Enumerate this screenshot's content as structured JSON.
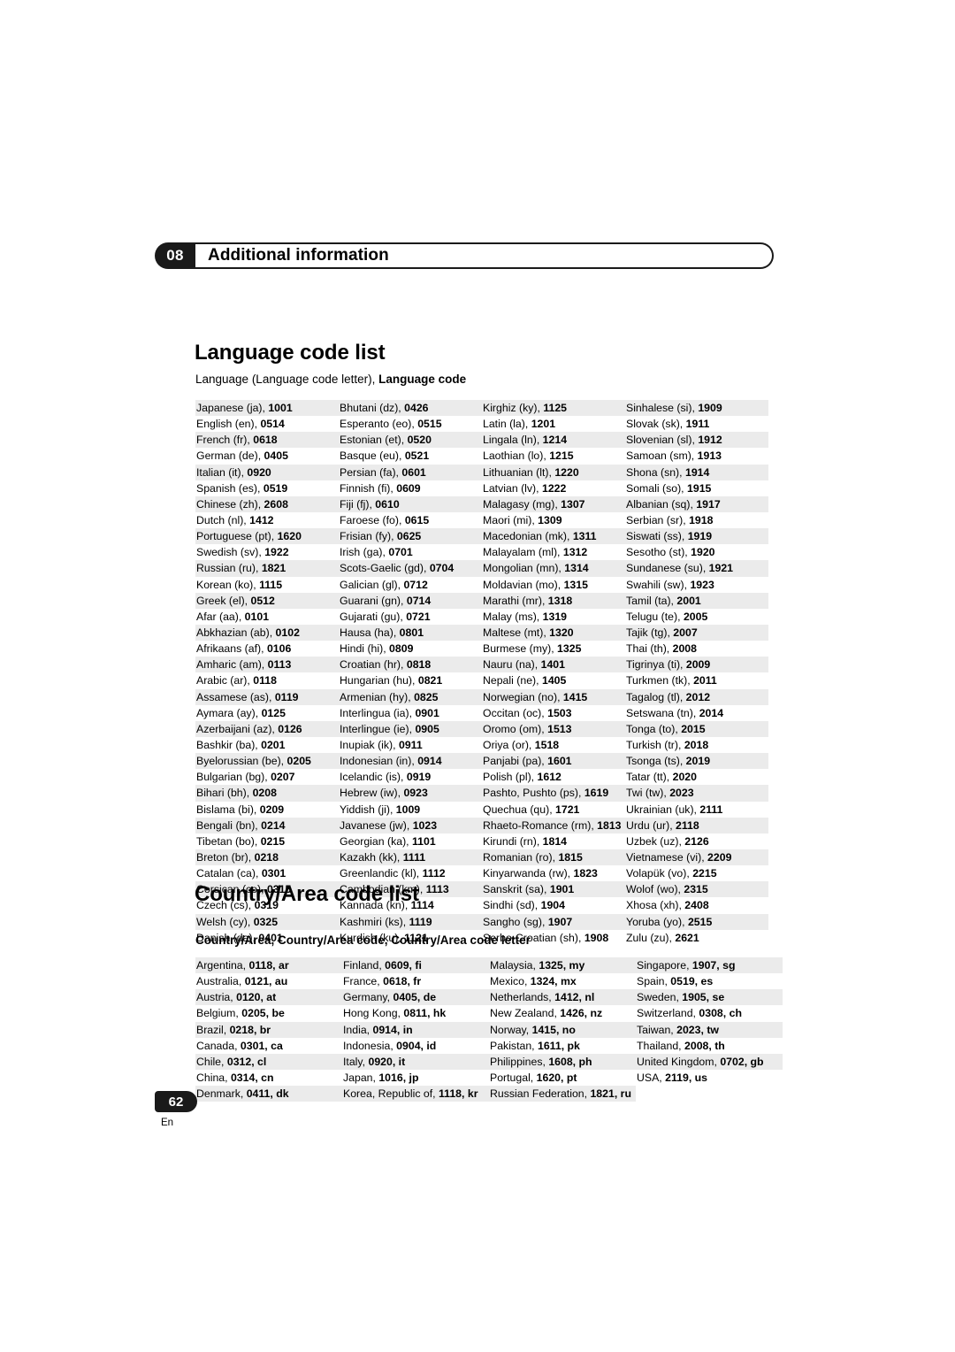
{
  "chapter": {
    "number": "08",
    "title": "Additional information"
  },
  "language_section": {
    "title": "Language code list",
    "subtitle_plain": "Language (Language code letter), ",
    "subtitle_bold": "Language code",
    "columns": [
      [
        {
          "name": "Japanese (ja)",
          "code": "1001"
        },
        {
          "name": "English (en)",
          "code": "0514"
        },
        {
          "name": "French (fr)",
          "code": "0618"
        },
        {
          "name": "German (de)",
          "code": "0405"
        },
        {
          "name": "Italian (it)",
          "code": "0920"
        },
        {
          "name": "Spanish (es)",
          "code": "0519"
        },
        {
          "name": "Chinese (zh)",
          "code": "2608"
        },
        {
          "name": "Dutch (nl)",
          "code": "1412"
        },
        {
          "name": "Portuguese (pt)",
          "code": "1620"
        },
        {
          "name": "Swedish (sv)",
          "code": "1922"
        },
        {
          "name": "Russian (ru)",
          "code": "1821"
        },
        {
          "name": "Korean (ko)",
          "code": "1115"
        },
        {
          "name": "Greek (el)",
          "code": "0512"
        },
        {
          "name": "Afar (aa)",
          "code": "0101"
        },
        {
          "name": "Abkhazian (ab)",
          "code": "0102"
        },
        {
          "name": "Afrikaans (af)",
          "code": "0106"
        },
        {
          "name": "Amharic (am)",
          "code": "0113"
        },
        {
          "name": "Arabic (ar)",
          "code": "0118"
        },
        {
          "name": "Assamese (as)",
          "code": "0119"
        },
        {
          "name": "Aymara (ay)",
          "code": "0125"
        },
        {
          "name": "Azerbaijani (az)",
          "code": "0126"
        },
        {
          "name": "Bashkir (ba)",
          "code": "0201"
        },
        {
          "name": "Byelorussian (be)",
          "code": "0205"
        },
        {
          "name": "Bulgarian (bg)",
          "code": "0207"
        },
        {
          "name": "Bihari (bh)",
          "code": "0208"
        },
        {
          "name": "Bislama (bi)",
          "code": "0209"
        },
        {
          "name": "Bengali (bn)",
          "code": "0214"
        },
        {
          "name": "Tibetan (bo)",
          "code": "0215"
        },
        {
          "name": "Breton (br)",
          "code": "0218"
        },
        {
          "name": "Catalan (ca)",
          "code": "0301"
        },
        {
          "name": "Corsican (co)",
          "code": "0315"
        },
        {
          "name": "Czech (cs)",
          "code": "0319"
        },
        {
          "name": "Welsh (cy)",
          "code": "0325"
        },
        {
          "name": "Danish (da)",
          "code": "0401"
        }
      ],
      [
        {
          "name": "Bhutani (dz)",
          "code": "0426"
        },
        {
          "name": "Esperanto (eo)",
          "code": "0515"
        },
        {
          "name": "Estonian (et)",
          "code": "0520"
        },
        {
          "name": "Basque (eu)",
          "code": "0521"
        },
        {
          "name": "Persian (fa)",
          "code": "0601"
        },
        {
          "name": "Finnish (fi)",
          "code": "0609"
        },
        {
          "name": "Fiji (fj)",
          "code": "0610"
        },
        {
          "name": "Faroese (fo)",
          "code": "0615"
        },
        {
          "name": "Frisian (fy)",
          "code": "0625"
        },
        {
          "name": "Irish (ga)",
          "code": "0701"
        },
        {
          "name": "Scots-Gaelic (gd)",
          "code": "0704"
        },
        {
          "name": "Galician (gl)",
          "code": "0712"
        },
        {
          "name": "Guarani (gn)",
          "code": "0714"
        },
        {
          "name": "Gujarati (gu)",
          "code": "0721"
        },
        {
          "name": "Hausa (ha)",
          "code": "0801"
        },
        {
          "name": "Hindi (hi)",
          "code": "0809"
        },
        {
          "name": "Croatian (hr)",
          "code": "0818"
        },
        {
          "name": "Hungarian (hu)",
          "code": "0821"
        },
        {
          "name": "Armenian (hy)",
          "code": "0825"
        },
        {
          "name": "Interlingua (ia)",
          "code": "0901"
        },
        {
          "name": "Interlingue (ie)",
          "code": "0905"
        },
        {
          "name": "Inupiak (ik)",
          "code": "0911"
        },
        {
          "name": "Indonesian (in)",
          "code": "0914"
        },
        {
          "name": "Icelandic (is)",
          "code": "0919"
        },
        {
          "name": "Hebrew (iw)",
          "code": "0923"
        },
        {
          "name": "Yiddish (ji)",
          "code": "1009"
        },
        {
          "name": "Javanese (jw)",
          "code": "1023"
        },
        {
          "name": "Georgian (ka)",
          "code": "1101"
        },
        {
          "name": "Kazakh (kk)",
          "code": "1111"
        },
        {
          "name": "Greenlandic (kl)",
          "code": "1112"
        },
        {
          "name": "Cambodian (km)",
          "code": "1113"
        },
        {
          "name": "Kannada (kn)",
          "code": "1114"
        },
        {
          "name": "Kashmiri (ks)",
          "code": "1119"
        },
        {
          "name": "Kurdish (ku)",
          "code": "1121"
        }
      ],
      [
        {
          "name": "Kirghiz (ky)",
          "code": "1125"
        },
        {
          "name": "Latin (la)",
          "code": "1201"
        },
        {
          "name": "Lingala (ln)",
          "code": "1214"
        },
        {
          "name": "Laothian (lo)",
          "code": "1215"
        },
        {
          "name": "Lithuanian (lt)",
          "code": "1220"
        },
        {
          "name": "Latvian (lv)",
          "code": "1222"
        },
        {
          "name": "Malagasy (mg)",
          "code": "1307"
        },
        {
          "name": "Maori (mi)",
          "code": "1309"
        },
        {
          "name": "Macedonian (mk)",
          "code": "1311"
        },
        {
          "name": "Malayalam (ml)",
          "code": "1312"
        },
        {
          "name": "Mongolian (mn)",
          "code": "1314"
        },
        {
          "name": "Moldavian (mo)",
          "code": "1315"
        },
        {
          "name": "Marathi (mr)",
          "code": "1318"
        },
        {
          "name": "Malay (ms)",
          "code": "1319"
        },
        {
          "name": "Maltese (mt)",
          "code": "1320"
        },
        {
          "name": "Burmese (my)",
          "code": "1325"
        },
        {
          "name": "Nauru (na)",
          "code": "1401"
        },
        {
          "name": "Nepali (ne)",
          "code": "1405"
        },
        {
          "name": "Norwegian (no)",
          "code": "1415"
        },
        {
          "name": "Occitan (oc)",
          "code": "1503"
        },
        {
          "name": "Oromo (om)",
          "code": "1513"
        },
        {
          "name": "Oriya (or)",
          "code": "1518"
        },
        {
          "name": "Panjabi (pa)",
          "code": "1601"
        },
        {
          "name": "Polish (pl)",
          "code": "1612"
        },
        {
          "name": "Pashto, Pushto (ps)",
          "code": "1619"
        },
        {
          "name": "Quechua (qu)",
          "code": "1721"
        },
        {
          "name": "Rhaeto-Romance (rm)",
          "code": "1813"
        },
        {
          "name": "Kirundi (rn)",
          "code": "1814"
        },
        {
          "name": "Romanian (ro)",
          "code": "1815"
        },
        {
          "name": "Kinyarwanda (rw)",
          "code": "1823"
        },
        {
          "name": "Sanskrit (sa)",
          "code": "1901"
        },
        {
          "name": "Sindhi (sd)",
          "code": "1904"
        },
        {
          "name": "Sangho (sg)",
          "code": "1907"
        },
        {
          "name": "Serbo-Croatian (sh)",
          "code": "1908"
        }
      ],
      [
        {
          "name": "Sinhalese (si)",
          "code": "1909"
        },
        {
          "name": "Slovak (sk)",
          "code": "1911"
        },
        {
          "name": "Slovenian (sl)",
          "code": "1912"
        },
        {
          "name": "Samoan (sm)",
          "code": "1913"
        },
        {
          "name": "Shona (sn)",
          "code": "1914"
        },
        {
          "name": "Somali (so)",
          "code": "1915"
        },
        {
          "name": "Albanian (sq)",
          "code": "1917"
        },
        {
          "name": "Serbian (sr)",
          "code": "1918"
        },
        {
          "name": "Siswati (ss)",
          "code": "1919"
        },
        {
          "name": "Sesotho (st)",
          "code": "1920"
        },
        {
          "name": "Sundanese (su)",
          "code": "1921"
        },
        {
          "name": "Swahili (sw)",
          "code": "1923"
        },
        {
          "name": "Tamil (ta)",
          "code": "2001"
        },
        {
          "name": "Telugu (te)",
          "code": "2005"
        },
        {
          "name": "Tajik (tg)",
          "code": "2007"
        },
        {
          "name": "Thai (th)",
          "code": "2008"
        },
        {
          "name": "Tigrinya (ti)",
          "code": "2009"
        },
        {
          "name": "Turkmen (tk)",
          "code": "2011"
        },
        {
          "name": "Tagalog (tl)",
          "code": "2012"
        },
        {
          "name": "Setswana (tn)",
          "code": "2014"
        },
        {
          "name": "Tonga (to)",
          "code": "2015"
        },
        {
          "name": "Turkish (tr)",
          "code": "2018"
        },
        {
          "name": "Tsonga (ts)",
          "code": "2019"
        },
        {
          "name": "Tatar (tt)",
          "code": "2020"
        },
        {
          "name": "Twi (tw)",
          "code": "2023"
        },
        {
          "name": "Ukrainian (uk)",
          "code": "2111"
        },
        {
          "name": "Urdu (ur)",
          "code": "2118"
        },
        {
          "name": "Uzbek (uz)",
          "code": "2126"
        },
        {
          "name": "Vietnamese (vi)",
          "code": "2209"
        },
        {
          "name": "Volapük (vo)",
          "code": "2215"
        },
        {
          "name": "Wolof (wo)",
          "code": "2315"
        },
        {
          "name": "Xhosa (xh)",
          "code": "2408"
        },
        {
          "name": "Yoruba (yo)",
          "code": "2515"
        },
        {
          "name": "Zulu (zu)",
          "code": "2621"
        }
      ]
    ]
  },
  "country_section": {
    "title": "Country/Area code list",
    "subtitle": "Country/Area, Country/Area code, Country/Area code letter",
    "columns": [
      [
        {
          "name": "Argentina, ",
          "code": "0118",
          "letter": ", ar"
        },
        {
          "name": "Australia, ",
          "code": "0121",
          "letter": ", au"
        },
        {
          "name": "Austria, ",
          "code": "0120",
          "letter": ", at"
        },
        {
          "name": "Belgium, ",
          "code": "0205",
          "letter": ", be"
        },
        {
          "name": "Brazil, ",
          "code": "0218",
          "letter": ", br"
        },
        {
          "name": "Canada, ",
          "code": "0301",
          "letter": ", ca"
        },
        {
          "name": "Chile, ",
          "code": "0312",
          "letter": ", cl"
        },
        {
          "name": "China, ",
          "code": "0314",
          "letter": ", cn"
        },
        {
          "name": "Denmark, ",
          "code": "0411",
          "letter": ", dk"
        }
      ],
      [
        {
          "name": "Finland, ",
          "code": "0609",
          "letter": ", fi"
        },
        {
          "name": "France, ",
          "code": "0618",
          "letter": ", fr"
        },
        {
          "name": "Germany, ",
          "code": "0405",
          "letter": ", de"
        },
        {
          "name": "Hong Kong, ",
          "code": "0811",
          "letter": ", hk"
        },
        {
          "name": "India, ",
          "code": "0914",
          "letter": ", in"
        },
        {
          "name": "Indonesia, ",
          "code": "0904",
          "letter": ", id"
        },
        {
          "name": "Italy, ",
          "code": "0920",
          "letter": ", it"
        },
        {
          "name": "Japan, ",
          "code": "1016",
          "letter": ", jp"
        },
        {
          "name": "Korea, Republic of, ",
          "code": "1118",
          "letter": ", kr"
        }
      ],
      [
        {
          "name": "Malaysia, ",
          "code": "1325",
          "letter": ", my"
        },
        {
          "name": "Mexico, ",
          "code": "1324",
          "letter": ", mx"
        },
        {
          "name": "Netherlands, ",
          "code": "1412",
          "letter": ", nl"
        },
        {
          "name": "New Zealand, ",
          "code": "1426",
          "letter": ", nz"
        },
        {
          "name": "Norway, ",
          "code": "1415",
          "letter": ", no"
        },
        {
          "name": "Pakistan, ",
          "code": "1611",
          "letter": ", pk"
        },
        {
          "name": "Philippines, ",
          "code": "1608",
          "letter": ", ph"
        },
        {
          "name": "Portugal, ",
          "code": "1620",
          "letter": ", pt"
        },
        {
          "name": "Russian Federation, ",
          "code": "1821",
          "letter": ", ru"
        }
      ],
      [
        {
          "name": "Singapore, ",
          "code": "1907",
          "letter": ", sg"
        },
        {
          "name": "Spain, ",
          "code": "0519",
          "letter": ", es"
        },
        {
          "name": "Sweden, ",
          "code": "1905",
          "letter": ", se"
        },
        {
          "name": "Switzerland, ",
          "code": "0308",
          "letter": ", ch"
        },
        {
          "name": "Taiwan, ",
          "code": "2023",
          "letter": ", tw"
        },
        {
          "name": "Thailand, ",
          "code": "2008",
          "letter": ", th"
        },
        {
          "name": "United Kingdom, ",
          "code": "0702",
          "letter": ", gb"
        },
        {
          "name": "USA, ",
          "code": "2119",
          "letter": ", us"
        }
      ]
    ]
  },
  "footer": {
    "page_number": "62",
    "language_mark": "En"
  }
}
